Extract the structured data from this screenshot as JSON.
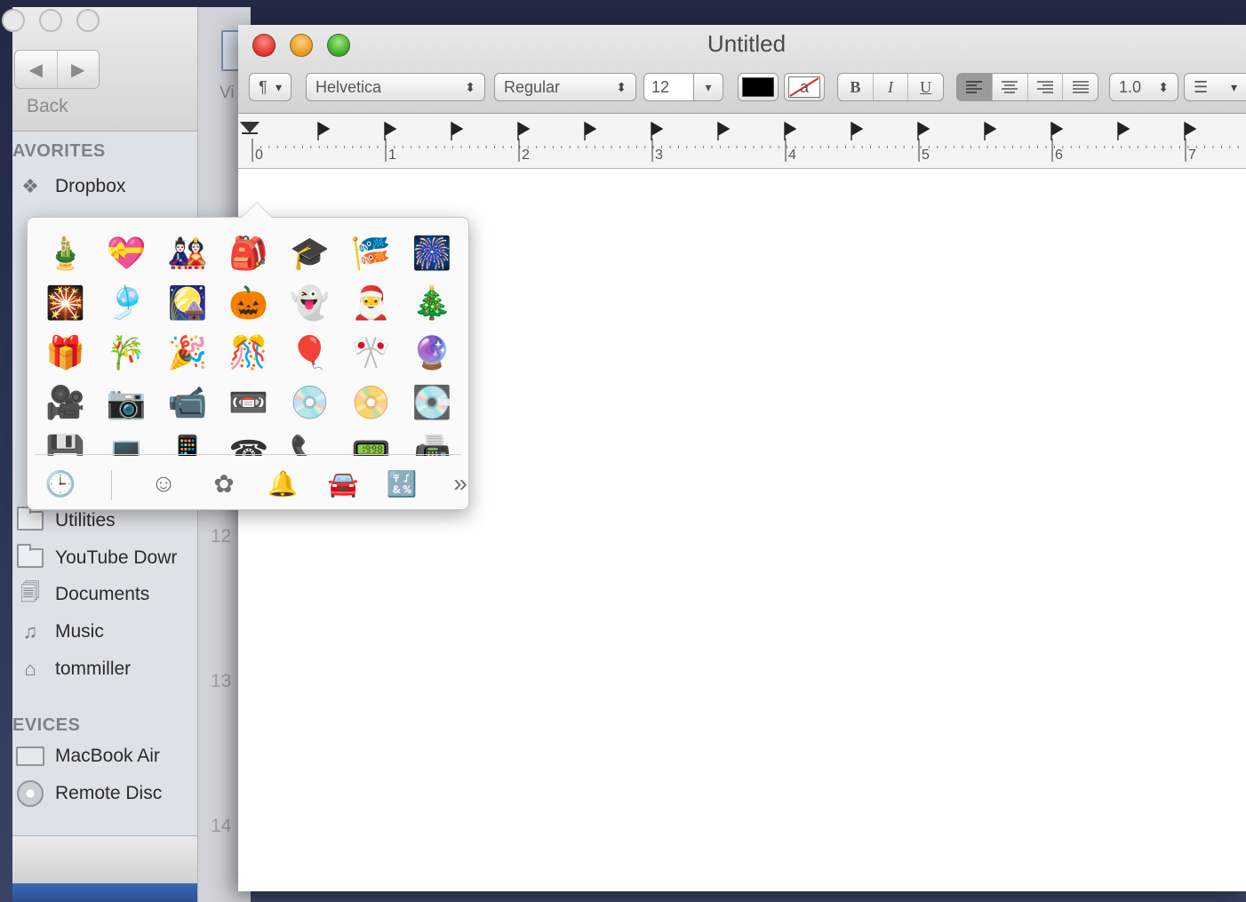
{
  "finder": {
    "back_label": "Back",
    "favorites_heading": "AVORITES",
    "devices_heading": "EVICES",
    "favorites": [
      {
        "label": "Dropbox",
        "icon": "dropbox-icon"
      },
      {
        "label": "Utilities",
        "icon": "folder-icon"
      },
      {
        "label": "YouTube Dowr",
        "icon": "folder-icon"
      },
      {
        "label": "Documents",
        "icon": "documents-icon"
      },
      {
        "label": "Music",
        "icon": "music-icon"
      },
      {
        "label": "tommiller",
        "icon": "home-icon"
      }
    ],
    "devices": [
      {
        "label": "MacBook Air",
        "icon": "laptop-icon"
      },
      {
        "label": "Remote Disc",
        "icon": "disc-icon"
      }
    ]
  },
  "background_window": {
    "partial_label": "Vi",
    "line_numbers": [
      "12",
      "13",
      "14"
    ]
  },
  "textedit": {
    "title": "Untitled",
    "toolbar": {
      "paragraph": "¶",
      "font_family": "Helvetica",
      "font_style": "Regular",
      "font_size": "12",
      "text_color": "#000000",
      "highlight_glyph": "a",
      "bold": "B",
      "italic": "I",
      "underline": "U",
      "line_spacing": "1.0",
      "list_glyph": "☰"
    },
    "ruler": {
      "numbers": [
        "0",
        "1",
        "2",
        "3",
        "4",
        "5",
        "6",
        "7"
      ]
    }
  },
  "emoji_picker": {
    "emojis": [
      "🎍",
      "💝",
      "🎎",
      "🎒",
      "🎓",
      "🎏",
      "🎆",
      "🎇",
      "🎐",
      "🎑",
      "🎃",
      "👻",
      "🎅",
      "🎄",
      "🎁",
      "🎋",
      "🎉",
      "🎊",
      "🎈",
      "🎌",
      "🔮",
      "🎥",
      "📷",
      "📹",
      "📼",
      "💿",
      "📀",
      "💽",
      "💾",
      "💻",
      "📱",
      "☎",
      "📞",
      "📟",
      "📠"
    ],
    "categories": [
      {
        "name": "recent",
        "glyph": "🕒",
        "icon": "clock-icon"
      },
      {
        "name": "people",
        "glyph": "☺",
        "icon": "smiley-icon"
      },
      {
        "name": "nature",
        "glyph": "✿",
        "icon": "flower-icon"
      },
      {
        "name": "objects",
        "glyph": "🔔",
        "icon": "bell-icon"
      },
      {
        "name": "places",
        "glyph": "🚘",
        "icon": "car-icon"
      },
      {
        "name": "symbols",
        "glyph": "🔣",
        "icon": "symbols-icon"
      },
      {
        "name": "more",
        "glyph": "»",
        "icon": "more-icon"
      }
    ],
    "active_category_color": "#2a7ae2"
  }
}
